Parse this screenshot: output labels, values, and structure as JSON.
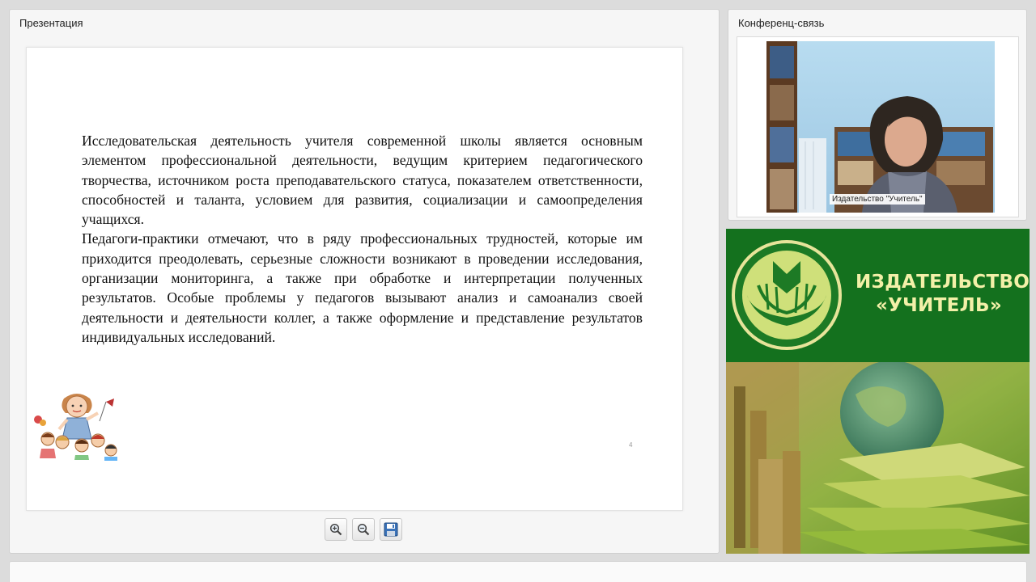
{
  "presentation": {
    "title": "Презентация",
    "slide": {
      "paragraphs": [
        "Исследовательская деятельность учителя современной школы является основным элементом профессиональной деятельности, ведущим критерием педагогического творчества, источником роста преподавательского статуса, показателем ответственности, способностей и таланта, условием для развития, социализации и самоопределения учащихся.",
        "Педагоги-практики отмечают, что в ряду профессиональных трудностей, которые им приходится преодолевать, серьезные сложности возникают в проведении исследования, организации мониторинга, а также при обработке и интерпретации полученных результатов. Особые проблемы у педагогов вызывают анализ и самоанализ своей деятельности и деятельности коллег, а также оформление и представление результатов индивидуальных исследований."
      ],
      "page_number": "4"
    },
    "toolbar": {
      "zoom_in_icon": "zoom-in-icon",
      "zoom_out_icon": "zoom-out-icon",
      "save_icon": "save-icon"
    }
  },
  "conference": {
    "title": "Конференц-связь",
    "video_caption": "Издательство \"Учитель\""
  },
  "banner": {
    "line1": "ИЗДАТЕЛЬСТВО",
    "line2": "«УЧИТЕЛЬ»",
    "colors": {
      "green": "#14711e",
      "text": "#f3f0a8"
    }
  }
}
